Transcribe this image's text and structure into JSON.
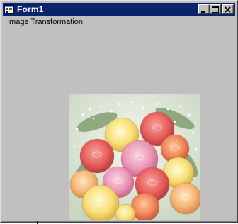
{
  "window": {
    "title": "Form1",
    "colors": {
      "titlebar": "#0a246a",
      "face": "#c0c0c0"
    }
  },
  "controls": {
    "minimize_icon": "minimize-icon",
    "maximize_icon": "maximize-icon",
    "close_icon": "close-icon"
  },
  "content": {
    "label_text": "Image Transformation",
    "picture": "roses-bouquet"
  }
}
